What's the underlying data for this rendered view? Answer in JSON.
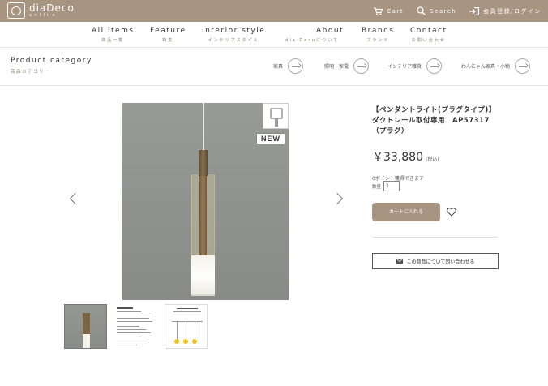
{
  "header": {
    "logo_name": "diaDeco",
    "logo_sub": "online",
    "cart_label": "Cart",
    "search_label": "Search",
    "login_label": "会員登録/ログイン"
  },
  "nav": {
    "items": [
      {
        "en": "All items",
        "jp": "商品一覧"
      },
      {
        "en": "Feature",
        "jp": "特集"
      },
      {
        "en": "Interior style",
        "jp": "インテリアスタイル"
      },
      {
        "en": "About",
        "jp": "dia Decoについて"
      },
      {
        "en": "Brands",
        "jp": "ブランド"
      },
      {
        "en": "Contact",
        "jp": "お問い合わせ"
      }
    ]
  },
  "category": {
    "title_en": "Product category",
    "title_jp": "商品カテゴリー",
    "links": [
      "家具",
      "照明・家電",
      "インテリア雑貨",
      "わんにゃん家具・小物"
    ]
  },
  "product": {
    "badge": "NEW",
    "title": "【ペンダントライト(プラグタイプ)】ダクトレール取付専用　AP57317（プラグ）",
    "price": "￥33,880",
    "tax_note": "(税込)",
    "points": "0ポイント獲得できます",
    "qty_label": "数量",
    "qty_value": "1",
    "cart_button": "カートに入れる",
    "inquiry_button": "この商品について問い合わせる"
  },
  "colors": {
    "brand": "#a79481",
    "image_bg": "#8f918d"
  }
}
